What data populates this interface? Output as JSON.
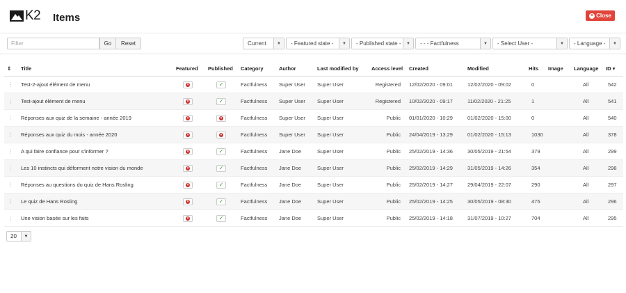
{
  "header": {
    "logo_text": "K2",
    "title": "Items",
    "close_label": "Close",
    "close_color": "#e0443a"
  },
  "toolbar": {
    "filter_placeholder": "Filter",
    "go_label": "Go",
    "reset_label": "Reset",
    "selects": [
      {
        "label": "Current"
      },
      {
        "label": "- Featured state -"
      },
      {
        "label": "- Published state -"
      },
      {
        "label": "- - - Factfulness"
      },
      {
        "label": "- Select User -"
      },
      {
        "label": "- Language -"
      }
    ]
  },
  "table": {
    "columns": {
      "sort_icon": "⇕",
      "title": "Title",
      "featured": "Featured",
      "published": "Published",
      "category": "Category",
      "author": "Author",
      "last_modified_by": "Last modified by",
      "access_level": "Access level",
      "created": "Created",
      "modified": "Modified",
      "hits": "Hits",
      "image": "Image",
      "language": "Language",
      "id": "ID ▾"
    },
    "rows": [
      {
        "title": "Test-2-ajout élément de menu",
        "featured": false,
        "published": true,
        "category": "Factfulness",
        "author": "Super User",
        "last_modified_by": "Super User",
        "access": "Registered",
        "created": "12/02/2020 - 09:01",
        "modified": "12/02/2020 - 09:02",
        "hits": "0",
        "language": "All",
        "id": "542"
      },
      {
        "title": "Test-ajout élément de menu",
        "featured": false,
        "published": true,
        "category": "Factfulness",
        "author": "Super User",
        "last_modified_by": "Super User",
        "access": "Registered",
        "created": "10/02/2020 - 09:17",
        "modified": "11/02/2020 - 21:25",
        "hits": "1",
        "language": "All",
        "id": "541"
      },
      {
        "title": "Réponses aux quiz de la semaine - année 2019",
        "featured": false,
        "published": false,
        "category": "Factfulness",
        "author": "Super User",
        "last_modified_by": "Super User",
        "access": "Public",
        "created": "01/01/2020 - 10:29",
        "modified": "01/02/2020 - 15:00",
        "hits": "0",
        "language": "All",
        "id": "540"
      },
      {
        "title": "Réponses aux quiz du mois - année 2020",
        "featured": false,
        "published": false,
        "category": "Factfulness",
        "author": "Super User",
        "last_modified_by": "Super User",
        "access": "Public",
        "created": "24/04/2019 - 13:29",
        "modified": "01/02/2020 - 15:13",
        "hits": "1030",
        "language": "All",
        "id": "378"
      },
      {
        "title": "A qui faire confiance pour s'informer ?",
        "featured": false,
        "published": true,
        "category": "Factfulness",
        "author": "Jane Doe",
        "last_modified_by": "Super User",
        "access": "Public",
        "created": "25/02/2019 - 14:36",
        "modified": "30/05/2019 - 21:54",
        "hits": "379",
        "language": "All",
        "id": "299"
      },
      {
        "title": "Les 10 instincts qui déforment notre vision du monde",
        "featured": false,
        "published": true,
        "category": "Factfulness",
        "author": "Jane Doe",
        "last_modified_by": "Super User",
        "access": "Public",
        "created": "25/02/2019 - 14:29",
        "modified": "31/05/2019 - 14:26",
        "hits": "354",
        "language": "All",
        "id": "298"
      },
      {
        "title": "Réponses au questions du quiz de Hans Rosling",
        "featured": false,
        "published": true,
        "category": "Factfulness",
        "author": "Jane Doe",
        "last_modified_by": "Super User",
        "access": "Public",
        "created": "25/02/2019 - 14:27",
        "modified": "29/04/2019 - 22:07",
        "hits": "290",
        "language": "All",
        "id": "297"
      },
      {
        "title": "Le quiz de Hans Rosling",
        "featured": false,
        "published": true,
        "category": "Factfulness",
        "author": "Jane Doe",
        "last_modified_by": "Super User",
        "access": "Public",
        "created": "25/02/2019 - 14:25",
        "modified": "30/05/2019 - 08:30",
        "hits": "475",
        "language": "All",
        "id": "296"
      },
      {
        "title": "Une vision basée sur les faits",
        "featured": false,
        "published": true,
        "category": "Factfulness",
        "author": "Jane Doe",
        "last_modified_by": "Super User",
        "access": "Public",
        "created": "25/02/2019 - 14:18",
        "modified": "31/07/2019 - 10:27",
        "hits": "704",
        "language": "All",
        "id": "295"
      }
    ]
  },
  "pagination": {
    "limit_value": "20"
  }
}
